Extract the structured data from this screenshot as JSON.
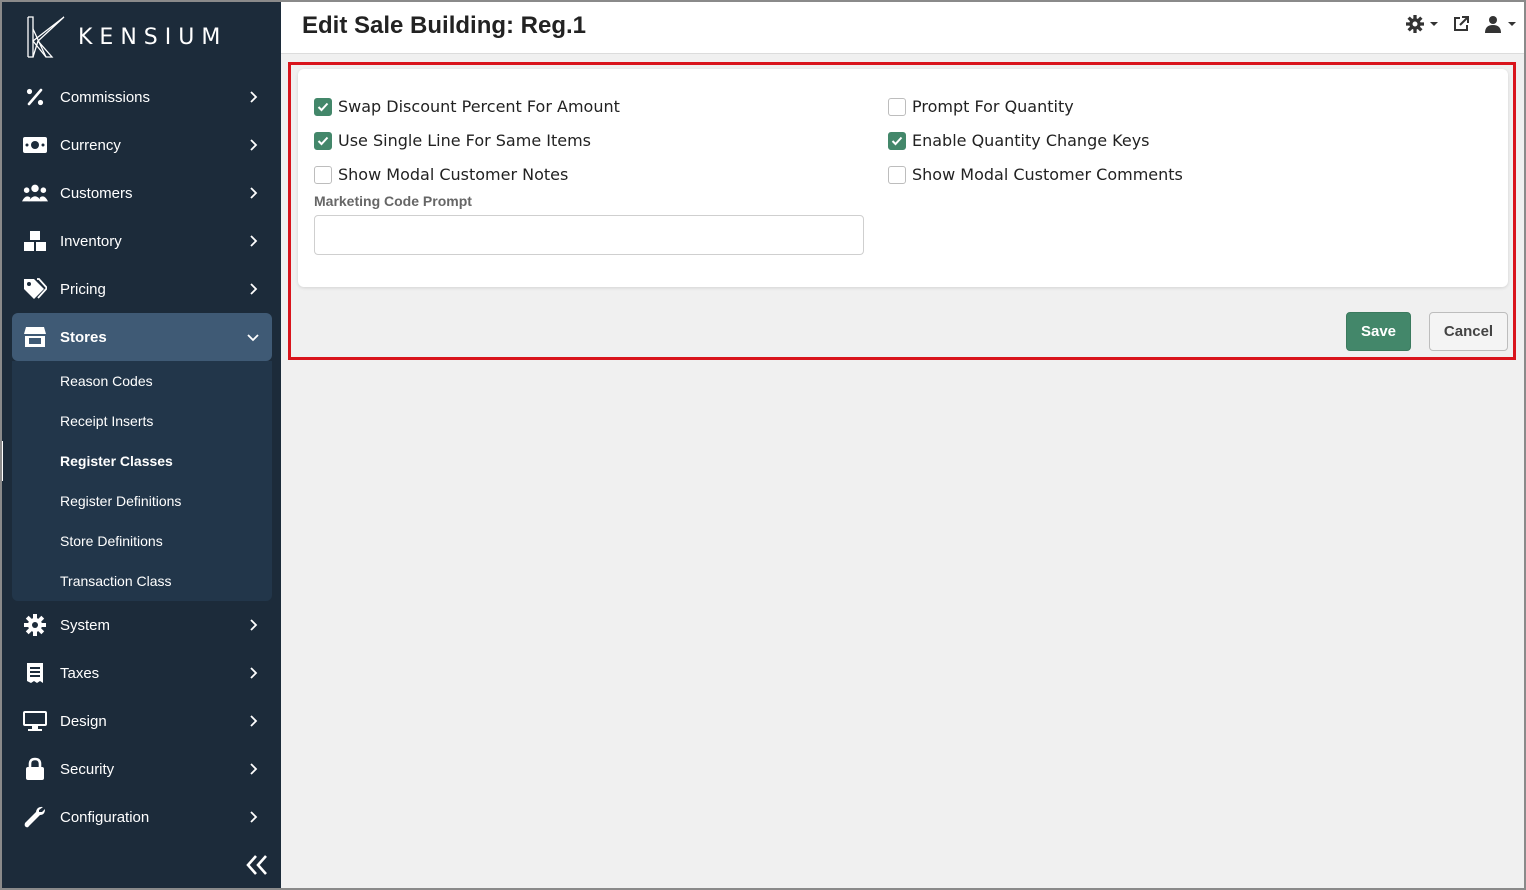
{
  "app": {
    "brand": "KENSIUM"
  },
  "header": {
    "title": "Edit Sale Building: Reg.1"
  },
  "sidebar": {
    "items": [
      {
        "label": "Commissions",
        "icon": "percent-icon"
      },
      {
        "label": "Currency",
        "icon": "money-icon"
      },
      {
        "label": "Customers",
        "icon": "users-icon"
      },
      {
        "label": "Inventory",
        "icon": "boxes-icon"
      },
      {
        "label": "Pricing",
        "icon": "tags-icon"
      },
      {
        "label": "Stores",
        "icon": "store-icon",
        "expanded": true
      },
      {
        "label": "System",
        "icon": "gear-icon"
      },
      {
        "label": "Taxes",
        "icon": "receipt-icon"
      },
      {
        "label": "Design",
        "icon": "monitor-icon"
      },
      {
        "label": "Security",
        "icon": "lock-icon"
      },
      {
        "label": "Configuration",
        "icon": "wrench-icon"
      }
    ],
    "stores_submenu": [
      {
        "label": "Reason Codes"
      },
      {
        "label": "Receipt Inserts"
      },
      {
        "label": "Register Classes",
        "current": true
      },
      {
        "label": "Register Definitions"
      },
      {
        "label": "Store Definitions"
      },
      {
        "label": "Transaction Class"
      }
    ]
  },
  "form": {
    "checkboxes": [
      {
        "label": "Swap Discount Percent For Amount",
        "checked": true
      },
      {
        "label": "Use Single Line For Same Items",
        "checked": true
      },
      {
        "label": "Show Modal Customer Notes",
        "checked": false
      },
      {
        "label": "Prompt For Quantity",
        "checked": false
      },
      {
        "label": "Enable Quantity Change Keys",
        "checked": true
      },
      {
        "label": "Show Modal Customer Comments",
        "checked": false
      }
    ],
    "marketing_code_prompt": {
      "label": "Marketing Code Prompt",
      "value": ""
    },
    "save_label": "Save",
    "cancel_label": "Cancel"
  },
  "colors": {
    "sidebar_bg": "#1c2b3a",
    "sidebar_active": "#3f5a75",
    "accent_green": "#43876a",
    "highlight_red": "#d9141c"
  }
}
